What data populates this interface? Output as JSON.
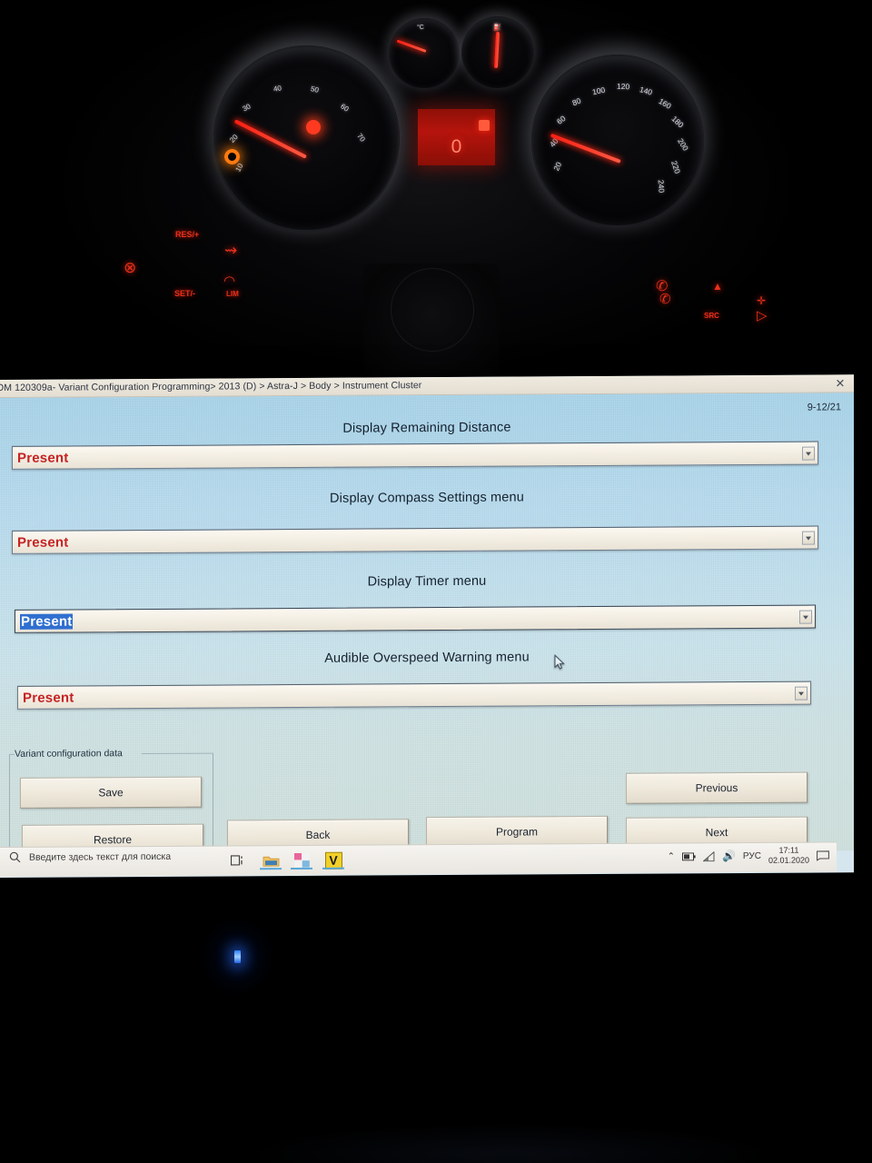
{
  "window": {
    "titlebar_text": "OM 120309a- Variant Configuration Programming> 2013 (D) > Astra-J > Body > Instrument Cluster",
    "close_icon": "close-icon",
    "page_indicator": "9-12/21"
  },
  "fields": [
    {
      "label": "Display Remaining Distance",
      "value": "Present",
      "selected": false
    },
    {
      "label": "Display Compass Settings menu",
      "value": "Present",
      "selected": false
    },
    {
      "label": "Display Timer menu",
      "value": "Present",
      "selected": true
    },
    {
      "label": "Audible Overspeed Warning menu",
      "value": "Present",
      "selected": false
    }
  ],
  "group": {
    "legend": "Variant configuration data",
    "save_label": "Save",
    "restore_label": "Restore"
  },
  "nav": {
    "back_label": "Back",
    "program_label": "Program",
    "previous_label": "Previous",
    "next_label": "Next"
  },
  "taskbar": {
    "search_placeholder": "Введите здесь текст для поиска",
    "search_icon": "search-icon",
    "icons": [
      {
        "name": "task-view-icon",
        "glyph": "▣"
      },
      {
        "name": "file-explorer-icon",
        "glyph": "🗀"
      },
      {
        "name": "microsoft-store-icon",
        "glyph": "▦"
      },
      {
        "name": "v-app-icon",
        "glyph": "V"
      }
    ],
    "tray": {
      "chevron_up_icon": "⌃",
      "battery_icon": "battery-icon",
      "network_icon": "network-icon",
      "volume_icon": "🔊",
      "language": "РУС",
      "time": "17:11",
      "date": "02.01.2020",
      "action_center_icon": "notification-icon"
    }
  },
  "dashboard": {
    "lcd_top_text": "",
    "lcd_odometer": "0",
    "tach_ticks": [
      "10",
      "20",
      "30",
      "40",
      "50",
      "60",
      "70"
    ],
    "speedo_ticks": [
      "20",
      "40",
      "60",
      "80",
      "100",
      "120",
      "140",
      "160",
      "180",
      "200",
      "220",
      "240"
    ],
    "tell_tales": [
      {
        "name": "cruise-off-icon",
        "text": ""
      },
      {
        "name": "cruise-resume-icon",
        "text": "RES/+"
      },
      {
        "name": "cruise-set-icon",
        "text": "SET/-"
      },
      {
        "name": "speed-limiter-icon",
        "text": "LIM"
      },
      {
        "name": "phone-icon",
        "text": ""
      },
      {
        "name": "source-icon",
        "text": "SRC"
      },
      {
        "name": "volume-icon",
        "text": ""
      }
    ]
  },
  "colors": {
    "accent_red": "#c62424",
    "selection_blue": "#2f6fd0",
    "dialog_blue": "#a9d4ea",
    "tell_tale_red": "#e8301a"
  }
}
